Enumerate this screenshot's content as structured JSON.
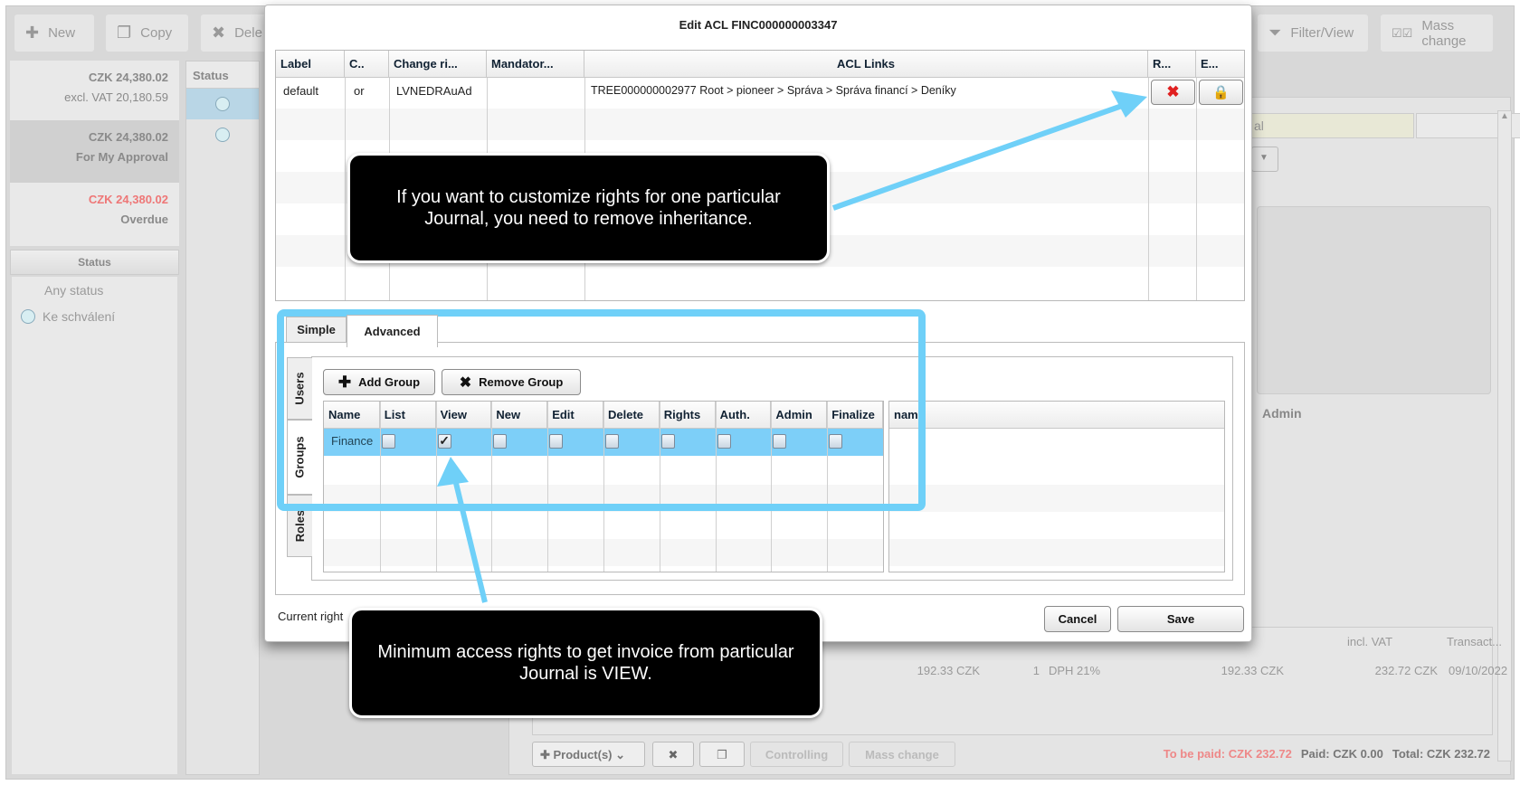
{
  "toolbar": {
    "new": "New",
    "copy": "Copy",
    "delete": "Dele",
    "filter_view": "Filter/View",
    "mass_change": "Mass change"
  },
  "summary_cards": [
    {
      "amount": "CZK 24,380.02",
      "label": "excl. VAT 20,180.59"
    },
    {
      "amount": "CZK 24,380.02",
      "label": "For My Approval"
    },
    {
      "amount": "CZK 24,380.02",
      "label": "Overdue"
    }
  ],
  "status_filter": {
    "header": "Status",
    "items": [
      "Any status",
      "Ke schválení"
    ]
  },
  "list": {
    "status_header": "Status"
  },
  "detail": {
    "step_label": "al",
    "admin_label": "Admin",
    "lines_headers": [
      "incl. VAT",
      "Transact..."
    ],
    "line": {
      "price": "192.33 CZK",
      "qty": "1",
      "vat": "DPH 21%",
      "excl": "192.33 CZK",
      "incl": "232.72 CZK",
      "date": "09/10/2022"
    },
    "bottom": {
      "products": "Product(s)",
      "controlling": "Controlling",
      "mass_change": "Mass change"
    },
    "totals": {
      "to_be_paid": "To be paid: CZK 232.72",
      "paid": "Paid: CZK 0.00",
      "total": "Total: CZK 232.72"
    }
  },
  "dialog": {
    "title": "Edit ACL FINC000000003347",
    "acl_table": {
      "headers": [
        "Label",
        "C..",
        "Change ri...",
        "Mandator...",
        "ACL Links",
        "R...",
        "E..."
      ],
      "rows": [
        {
          "label": "default",
          "c": "or",
          "change_rights": "LVNEDRAuAd",
          "mandatory": "",
          "acl_links": "TREE000000002977 Root > pioneer > Správa > Správa financí > Deníky"
        }
      ]
    },
    "tabs": [
      "Simple",
      "Advanced"
    ],
    "active_tab": "Advanced",
    "side_tabs": [
      "Users",
      "Groups",
      "Roles"
    ],
    "active_side_tab": "Groups",
    "add_group": "Add Group",
    "remove_group": "Remove Group",
    "group_table": {
      "headers": [
        "Name",
        "List",
        "View",
        "New",
        "Edit",
        "Delete",
        "Rights",
        "Auth.",
        "Admin",
        "Finalize"
      ],
      "rows": [
        {
          "name": "Finance",
          "checks": [
            false,
            true,
            false,
            false,
            false,
            false,
            false,
            false,
            false
          ]
        }
      ]
    },
    "side_table_header": "nam",
    "current_rights": "Current right",
    "cancel": "Cancel",
    "save": "Save"
  },
  "annotations": {
    "callout1": "If you want to customize rights for one particular Journal, you need to remove inheritance.",
    "callout2": "Minimum access rights to get invoice from particular Journal is VIEW.",
    "color": "#6fd0f8"
  }
}
